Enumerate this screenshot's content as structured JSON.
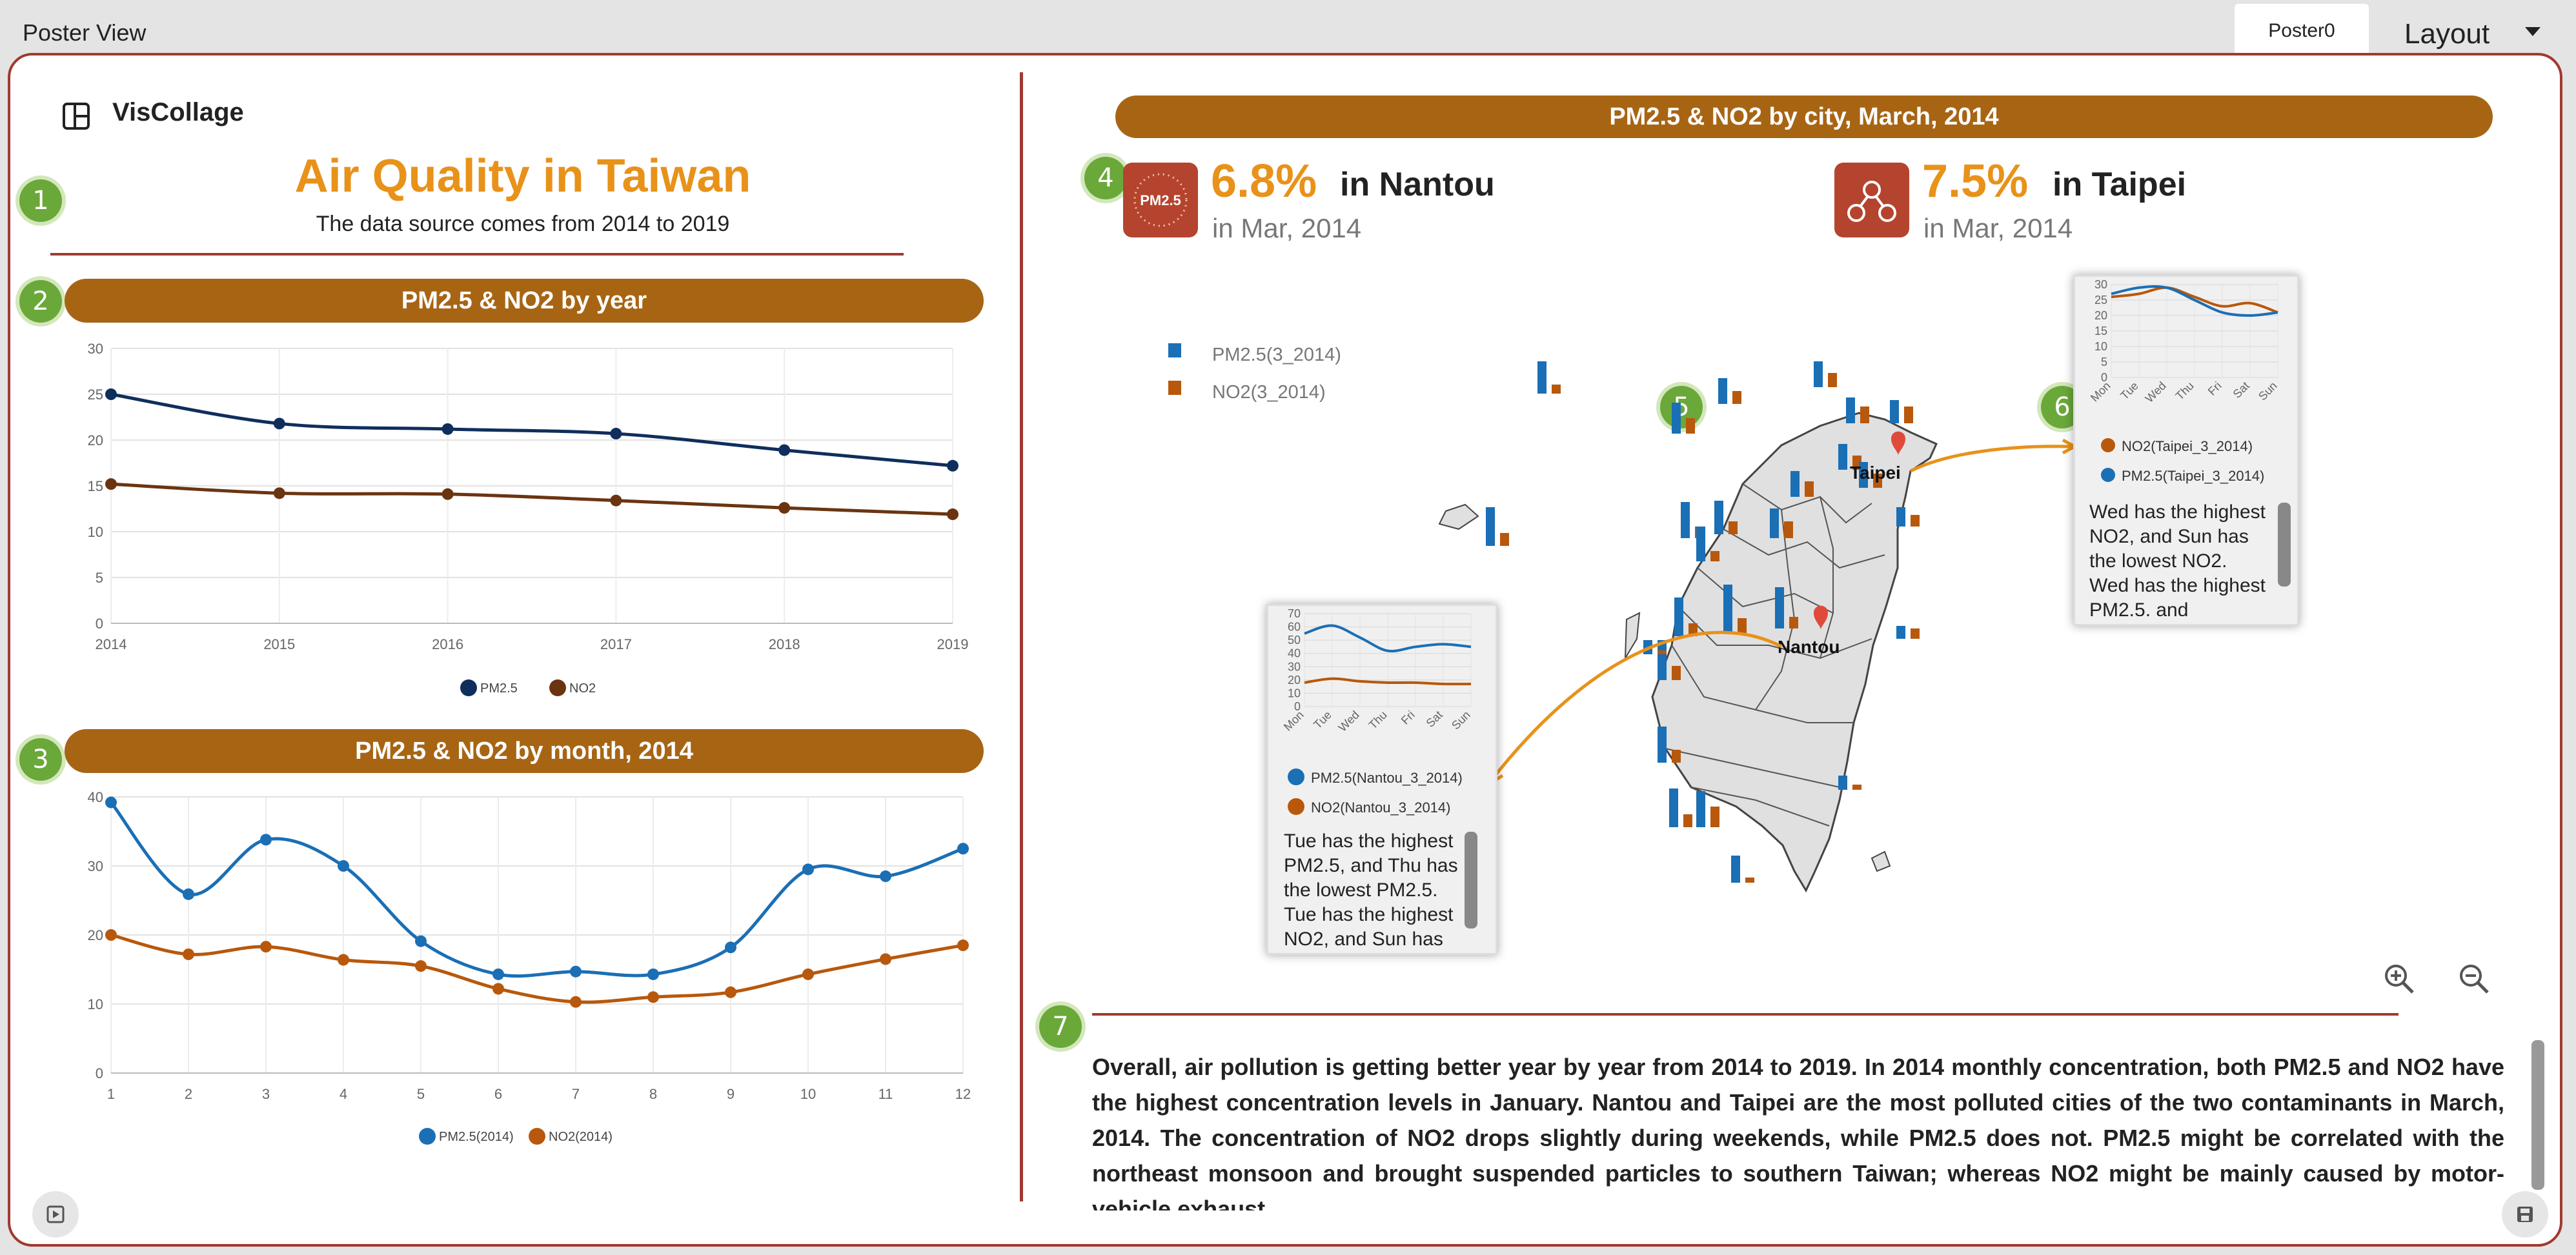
{
  "app": {
    "title": "Poster View",
    "tab": "Poster0",
    "layout_label": "Layout"
  },
  "logo": {
    "name": "VisCollage"
  },
  "poster": {
    "title": "Air Quality in Taiwan",
    "subtitle": "The data source comes from 2014 to 2019",
    "section1": "PM2.5 & NO2 by year",
    "section2": "PM2.5 & NO2 by month, 2014",
    "section3": "PM2.5 & NO2 by city, March, 2014",
    "badges": [
      "1",
      "2",
      "3",
      "4",
      "5",
      "6",
      "7"
    ]
  },
  "stats": [
    {
      "value": "6.8%",
      "label": "in Nantou",
      "sub": "in Mar, 2014",
      "icon": "pm25-icon",
      "icon_text": "PM2.5"
    },
    {
      "value": "7.5%",
      "label": "in Taipei",
      "sub": "in Mar, 2014",
      "icon": "no2-molecule-icon"
    }
  ],
  "map": {
    "legend": [
      "PM2.5(3_2014)",
      "NO2(3_2014)"
    ],
    "city_labels": [
      "Taipei",
      "Nantou"
    ],
    "popup_taipei": {
      "y_ticks": [
        "30",
        "25",
        "20",
        "15",
        "10",
        "5",
        "0"
      ],
      "x_ticks": [
        "Mon",
        "Tue",
        "Wed",
        "Thu",
        "Fri",
        "Sat",
        "Sun"
      ],
      "legend": [
        "NO2(Taipei_3_2014)",
        "PM2.5(Taipei_3_2014)"
      ],
      "text": "Wed has the highest NO2, and Sun has the lowest NO2. Wed has the highest PM2.5, and"
    },
    "popup_nantou": {
      "y_ticks": [
        "70",
        "60",
        "50",
        "40",
        "30",
        "20",
        "10",
        "0"
      ],
      "x_ticks": [
        "Mon",
        "Tue",
        "Wed",
        "Thu",
        "Fri",
        "Sat",
        "Sun"
      ],
      "legend": [
        "PM2.5(Nantou_3_2014)",
        "NO2(Nantou_3_2014)"
      ],
      "text": "Tue has the highest PM2.5, and Thu has the lowest PM2.5. Tue has the highest NO2, and Sun has"
    }
  },
  "summary": "Overall, air pollution is getting better year by year from 2014 to 2019. In 2014 monthly concentration, both PM2.5 and NO2 have the highest concentration levels in January. Nantou and Taipei are the most polluted cities of the two contaminants in March, 2014. The concentration of NO2 drops slightly during weekends, while PM2.5 does not. PM2.5 might be correlated with the northeast monsoon and brought suspended particles to southern Taiwan; whereas NO2 might be mainly caused by motor-vehicle exhaust.",
  "colors": {
    "accent": "#e8921a",
    "banner": "#a76514",
    "border": "#a03a30",
    "pm25": "#1a6fb5",
    "no2": "#b8580c",
    "pm25_year": "#0f2e5c",
    "no2_year": "#6b3410",
    "badge": "#6aa83a"
  },
  "chart_data": [
    {
      "type": "line",
      "title": "PM2.5 & NO2 by year",
      "x": [
        "2014",
        "2015",
        "2016",
        "2017",
        "2018",
        "2019"
      ],
      "ylim": [
        0,
        30
      ],
      "y_ticks": [
        "0",
        "5",
        "10",
        "15",
        "20",
        "25",
        "30"
      ],
      "series": [
        {
          "name": "PM2.5",
          "values": [
            25.0,
            21.8,
            21.2,
            20.7,
            18.9,
            17.2
          ],
          "color": "#0f2e5c"
        },
        {
          "name": "NO2",
          "values": [
            15.2,
            14.2,
            14.1,
            13.4,
            12.6,
            11.9
          ],
          "color": "#6b3410"
        }
      ],
      "grid": true,
      "legend": "bottom"
    },
    {
      "type": "line",
      "title": "PM2.5 & NO2 by month, 2014",
      "x": [
        "1",
        "2",
        "3",
        "4",
        "5",
        "6",
        "7",
        "8",
        "9",
        "10",
        "11",
        "12"
      ],
      "ylim": [
        0,
        40
      ],
      "y_ticks": [
        "0",
        "10",
        "20",
        "30",
        "40"
      ],
      "series": [
        {
          "name": "PM2.5(2014)",
          "values": [
            39.2,
            25.9,
            33.8,
            30.0,
            19.1,
            14.3,
            14.7,
            14.3,
            18.2,
            29.5,
            28.5,
            32.5
          ],
          "color": "#1a6fb5"
        },
        {
          "name": "NO2(2014)",
          "values": [
            20.0,
            17.2,
            18.3,
            16.4,
            15.5,
            12.2,
            10.3,
            11.0,
            11.7,
            14.3,
            16.5,
            18.5
          ],
          "color": "#b8580c"
        }
      ],
      "grid": true,
      "legend": "bottom"
    }
  ]
}
